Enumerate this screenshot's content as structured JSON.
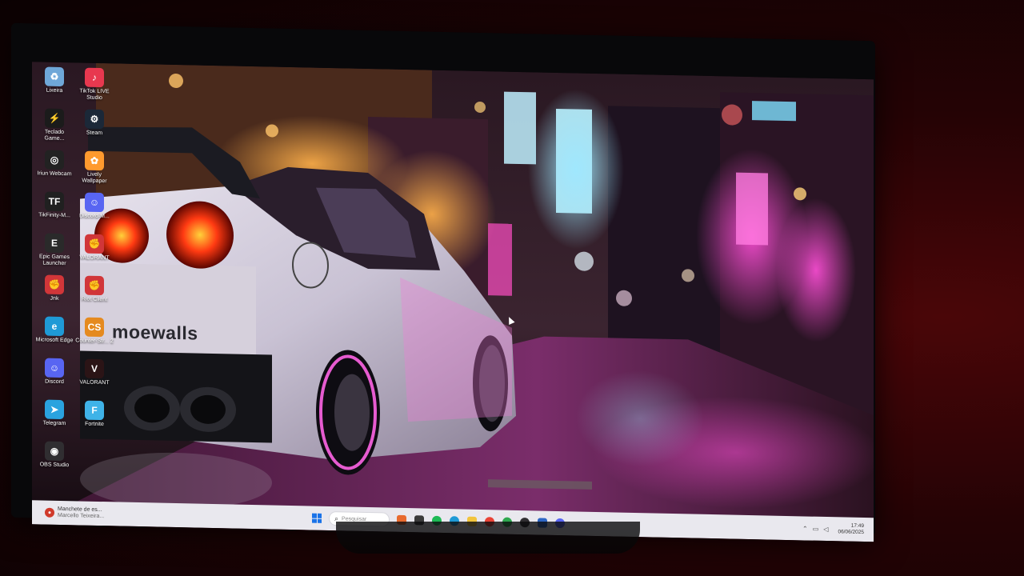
{
  "desktop": {
    "icons": [
      {
        "label": "Lixeira",
        "icon": "recycle-bin-icon",
        "color": "#6fa7d8",
        "glyph": "♻"
      },
      {
        "label": "TikTok LIVE Studio",
        "icon": "tiktok-live-icon",
        "color": "#e8384f",
        "glyph": "♪"
      },
      {
        "label": "Teclado Game...",
        "icon": "keyboard-game-icon",
        "color": "#1b1b1b",
        "glyph": "⚡"
      },
      {
        "label": "Steam",
        "icon": "steam-icon",
        "color": "#1b2838",
        "glyph": "⚙"
      },
      {
        "label": "Iriun Webcam",
        "icon": "iriun-webcam-icon",
        "color": "#222222",
        "glyph": "◎"
      },
      {
        "label": "Lively Wallpaper",
        "icon": "lively-wallpaper-icon",
        "color": "#ff9a2e",
        "glyph": "✿"
      },
      {
        "label": "TikFinity-M...",
        "icon": "tikfinity-icon",
        "color": "#202020",
        "glyph": "TF"
      },
      {
        "label": "Discord-M...",
        "icon": "discord-icon",
        "color": "#5865f2",
        "glyph": "☺"
      },
      {
        "label": "Epic Games Launcher",
        "icon": "epic-games-icon",
        "color": "#2a2a2a",
        "glyph": "E"
      },
      {
        "label": "VALORANT",
        "icon": "valorant-riot-icon",
        "color": "#d13639",
        "glyph": "✊"
      },
      {
        "label": "Jnk",
        "icon": "riot-jnk-icon",
        "color": "#d13639",
        "glyph": "✊"
      },
      {
        "label": "Riot Client",
        "icon": "riot-client-icon",
        "color": "#d13639",
        "glyph": "✊"
      },
      {
        "label": "Microsoft Edge",
        "icon": "edge-icon",
        "color": "#1f9ad6",
        "glyph": "e"
      },
      {
        "label": "Counter-Str... 2",
        "icon": "counter-strike-icon",
        "color": "#e58a1f",
        "glyph": "CS"
      },
      {
        "label": "Discord",
        "icon": "discord-icon",
        "color": "#5865f2",
        "glyph": "☺"
      },
      {
        "label": "VALORANT",
        "icon": "valorant-icon",
        "color": "#2b1416",
        "glyph": "V"
      },
      {
        "label": "Telegram",
        "icon": "telegram-icon",
        "color": "#2aa3df",
        "glyph": "➤"
      },
      {
        "label": "Fortnite",
        "icon": "fortnite-icon",
        "color": "#3fb3e8",
        "glyph": "F"
      },
      {
        "label": "OBS Studio",
        "icon": "obs-studio-icon",
        "color": "#302e31",
        "glyph": "◉"
      }
    ],
    "wallpaper_text": "moewalls"
  },
  "taskbar": {
    "news_title": "Manchete de es...",
    "news_subtitle": "Marcello Teixeira...",
    "search_placeholder": "Pesquisar",
    "apps": [
      {
        "name": "widgets-icon",
        "color": "#e86a2e"
      },
      {
        "name": "task-view-icon",
        "color": "#3a3a3a"
      },
      {
        "name": "spotify-icon",
        "color": "#1db954"
      },
      {
        "name": "edge-icon",
        "color": "#1f9ad6"
      },
      {
        "name": "file-explorer-icon",
        "color": "#f2c43c"
      },
      {
        "name": "chrome-icon",
        "color": "#e94235"
      },
      {
        "name": "xbox-icon",
        "color": "#2fa84f"
      },
      {
        "name": "obs-icon",
        "color": "#302e31"
      },
      {
        "name": "defender-icon",
        "color": "#2e66c4"
      },
      {
        "name": "discord-icon",
        "color": "#5865f2"
      }
    ],
    "time": "17:49",
    "date": "06/06/2025"
  }
}
